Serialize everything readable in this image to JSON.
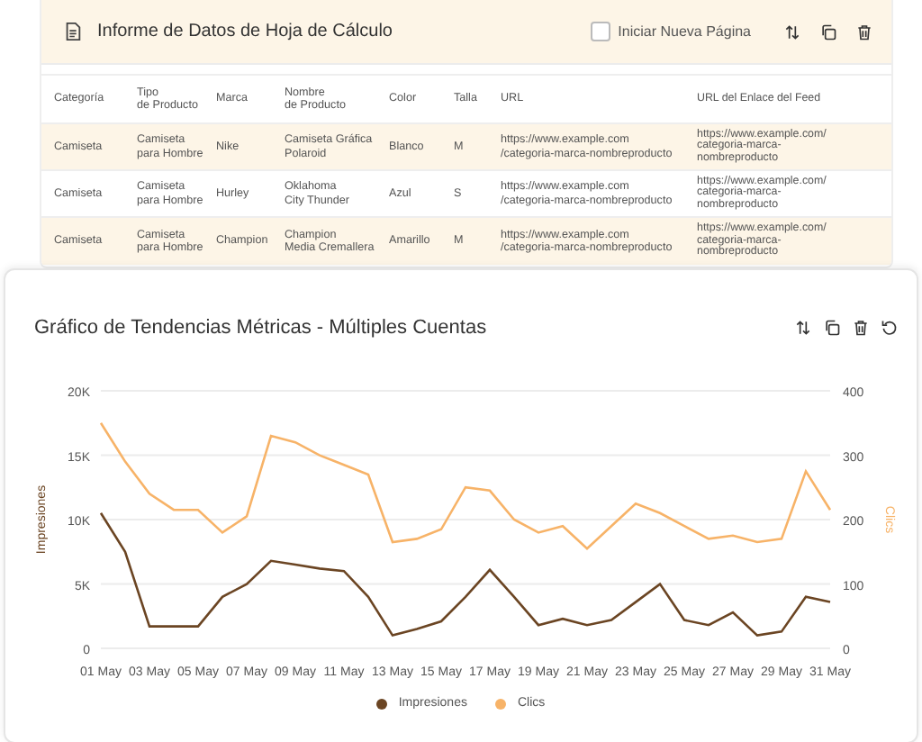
{
  "report": {
    "title": "Informe de Datos de Hoja de Cálculo",
    "new_page": {
      "label": "Iniciar Nueva Página",
      "checked": false
    },
    "table": {
      "columns": [
        "Categoría",
        "Tipo\nde Producto",
        "Marca",
        "Nombre\nde Producto",
        "Color",
        "Talla",
        "URL",
        "URL del Enlace del Feed"
      ],
      "rows": [
        [
          "Camiseta",
          "Camiseta\npara Hombre",
          "Nike",
          "Camiseta Gráfica\nPolaroid",
          "Blanco",
          "M",
          "https://www.example.com\n/categoria-marca-nombreproducto",
          "https://www.example.com/\ncategoria-marca-\nnombreproducto"
        ],
        [
          "Camiseta",
          "Camiseta\npara Hombre",
          "Hurley",
          "Oklahoma\nCity Thunder",
          "Azul",
          "S",
          "https://www.example.com\n/categoria-marca-nombreproducto",
          "https://www.example.com/\ncategoria-marca-\nnombreproducto"
        ],
        [
          "Camiseta",
          "Camiseta\npara Hombre",
          "Champion",
          "Champion\nMedia Cremallera",
          "Amarillo",
          "M",
          "https://www.example.com\n/categoria-marca-nombreproducto",
          "https://www.example.com/\ncategoria-marca-\nnombreproducto"
        ]
      ]
    }
  },
  "trend": {
    "title": "Gráfico de Tendencias Métricas - Múltiples Cuentas",
    "chart_data": {
      "type": "line",
      "ylabel": "Impresiones",
      "y2label": "Clics",
      "categories": [
        "01 May",
        null,
        "03 May",
        null,
        "05 May",
        null,
        "07 May",
        null,
        "09 May",
        null,
        "11 May",
        null,
        "13 May",
        null,
        "15 May",
        null,
        "17 May",
        null,
        "19 May",
        null,
        "21 May",
        null,
        "23 May",
        null,
        "25 May",
        null,
        "27 May",
        null,
        "29 May",
        null,
        "31 May"
      ],
      "grid": true,
      "ylim": [
        0,
        20000
      ],
      "yticks": [
        {
          "value": 0,
          "label": "0"
        },
        {
          "value": 5000,
          "label": "5K"
        },
        {
          "value": 10000,
          "label": "10K"
        },
        {
          "value": 15000,
          "label": "15K"
        },
        {
          "value": 20000,
          "label": "20K"
        }
      ],
      "y2lim": [
        0,
        400
      ],
      "y2ticks": [
        0,
        100,
        200,
        300,
        400
      ],
      "series": [
        {
          "name": "Impresiones",
          "color": "#6b4523",
          "values": [
            10500,
            7500,
            1700,
            1700,
            1700,
            4000,
            5000,
            6800,
            6500,
            6200,
            6000,
            4000,
            1000,
            1500,
            2100,
            4000,
            6100,
            4000,
            1800,
            2300,
            1800,
            2200,
            3600,
            5000,
            2200,
            1800,
            2800,
            1000,
            1300,
            4000,
            3600
          ]
        },
        {
          "name": "Clics",
          "color": "#f7b368",
          "axis": "y2",
          "values": [
            350,
            290,
            240,
            215,
            215,
            180,
            205,
            330,
            320,
            300,
            285,
            270,
            165,
            170,
            185,
            250,
            245,
            200,
            180,
            190,
            155,
            190,
            225,
            210,
            190,
            170,
            175,
            165,
            170,
            275,
            215
          ]
        }
      ]
    }
  }
}
